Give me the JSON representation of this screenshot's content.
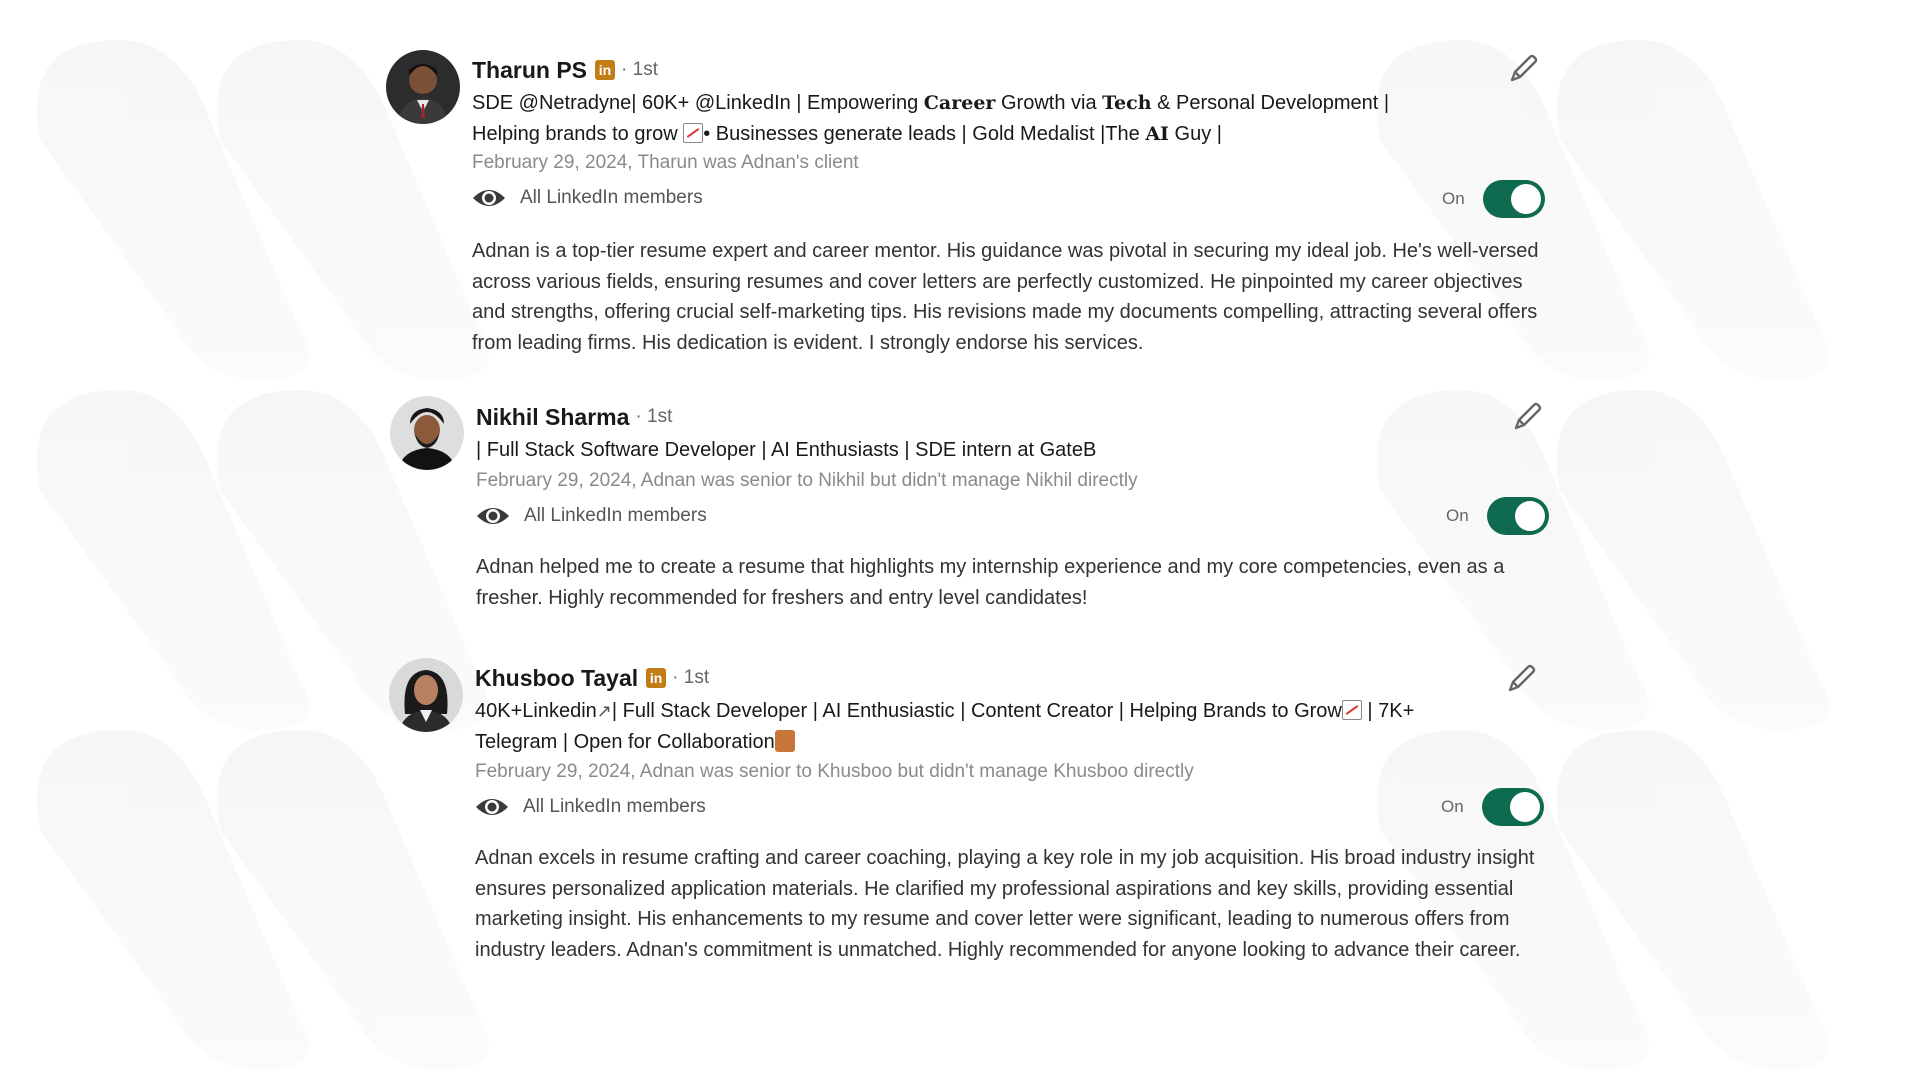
{
  "recommendations": [
    {
      "name": "Tharun PS",
      "has_badge": true,
      "badge_label": "in",
      "degree": "· 1st",
      "headline_parts": [
        "SDE @Netradyne| 60K+ @LinkedIn | Empowering ",
        "Career",
        " Growth via ",
        "Tech",
        " & Personal Development |\nHelping brands to grow ",
        "• Businesses generate leads | Gold Medalist |The ",
        "AI",
        " Guy |"
      ],
      "date_relation": "February 29, 2024, Tharun was Adnan's client",
      "visibility": "All LinkedIn members",
      "toggle_label": "On",
      "toggle_state": "on",
      "text": "Adnan is a top-tier resume expert and career mentor. His guidance was pivotal in securing my ideal job. He's well-versed across various fields, ensuring resumes and cover letters are perfectly customized. He pinpointed my career objectives and strengths, offering crucial self-marketing tips. His revisions made my documents compelling, attracting several offers from leading firms. His dedication is evident. I strongly endorse his services."
    },
    {
      "name": "Nikhil Sharma",
      "has_badge": false,
      "degree": "· 1st",
      "headline": "| Full Stack Software Developer | AI Enthusiasts | SDE intern at GateB",
      "date_relation": "February 29, 2024, Adnan was senior to Nikhil but didn't manage Nikhil directly",
      "visibility": "All LinkedIn members",
      "toggle_label": "On",
      "toggle_state": "on",
      "text": "Adnan helped me to create a resume that highlights my internship experience and my core competencies, even as a fresher. Highly recommended for freshers and entry level candidates!"
    },
    {
      "name": "Khusboo Tayal",
      "has_badge": true,
      "badge_label": "in",
      "degree": "· 1st",
      "headline_parts": [
        "40K+Linkedin",
        "| Full Stack Developer | AI Enthusiastic | Content Creator | Helping Brands to Grow",
        " | 7K+\nTelegram | Open for Collaboration"
      ],
      "date_relation": "February 29, 2024, Adnan was senior to Khusboo but didn't manage Khusboo directly",
      "visibility": "All LinkedIn members",
      "toggle_label": "On",
      "toggle_state": "on",
      "text": "Adnan excels in resume crafting and career coaching, playing a key role in my job acquisition. His broad industry insight ensures personalized application materials. He clarified my professional aspirations and key skills, providing essential marketing insight. His enhancements to my resume and cover letter were significant, leading to numerous offers from industry leaders. Adnan's commitment is unmatched. Highly recommended for anyone looking to advance their career."
    }
  ],
  "icons": {
    "visibility": "eye-icon",
    "edit": "pencil-icon",
    "badge": "linkedin-icon"
  },
  "colors": {
    "toggle_on": "#0e6b4f",
    "badge": "#c37d16",
    "date_text": "#8a8a8a"
  }
}
